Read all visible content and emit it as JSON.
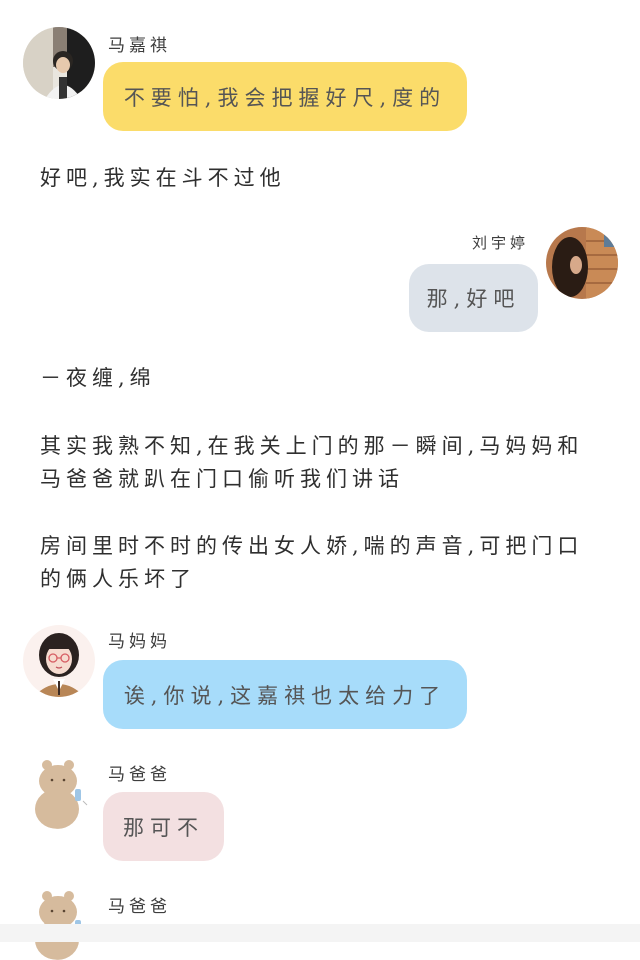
{
  "messages": [
    {
      "sender": "马嘉祺",
      "text": "不要怕,我会把握好尺,度的",
      "bubble_color": "#fbdc6a"
    },
    {
      "sender": "刘宇婷",
      "text": "那,好吧",
      "bubble_color": "#dde3ea"
    },
    {
      "sender": "马妈妈",
      "text": "诶,你说,这嘉祺也太给力了",
      "bubble_color": "#a7dcfa"
    },
    {
      "sender": "马爸爸",
      "text": "那可不",
      "bubble_color": "#f3e0e1"
    },
    {
      "sender": "马爸爸"
    }
  ],
  "narration": [
    "好吧,我实在斗不过他",
    "－夜缠,绵",
    "其实我熟不知,在我关上门的那－瞬间,马妈妈和马爸爸就趴在门口偷听我们讲话",
    "房间里时不时的传出女人娇,喘的声音,可把门口的俩人乐坏了"
  ],
  "icons": {
    "avatar_1": "boy-photo-avatar",
    "avatar_2": "girl-photo-avatar",
    "avatar_3": "cartoon-woman-avatar",
    "avatar_4": "bear-avatar"
  }
}
